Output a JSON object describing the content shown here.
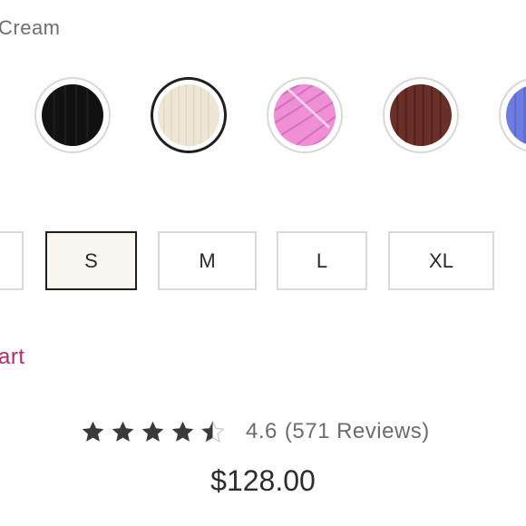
{
  "color_selector": {
    "selected_label": "Cream",
    "swatches": [
      {
        "name": "black",
        "color": "#111111"
      },
      {
        "name": "cream",
        "color": "#ede6d4"
      },
      {
        "name": "pink",
        "color": "#ef8fd6"
      },
      {
        "name": "brown",
        "color": "#6a2f27"
      },
      {
        "name": "periwinkle",
        "color": "#6e7be0"
      }
    ],
    "selected_index": 1
  },
  "size_selector": {
    "sizes": [
      "S",
      "M",
      "L",
      "XL"
    ],
    "selected": "S"
  },
  "cart": {
    "link_text": "art"
  },
  "rating": {
    "value": 4.6,
    "max_stars": 5,
    "display_value": "4.6",
    "reviews_text": "(571 Reviews)"
  },
  "price": {
    "text": "$128.00"
  },
  "colors": {
    "accent": "#b3286e",
    "star": "#3a3a3a",
    "star_empty": "#c9c9c9"
  }
}
